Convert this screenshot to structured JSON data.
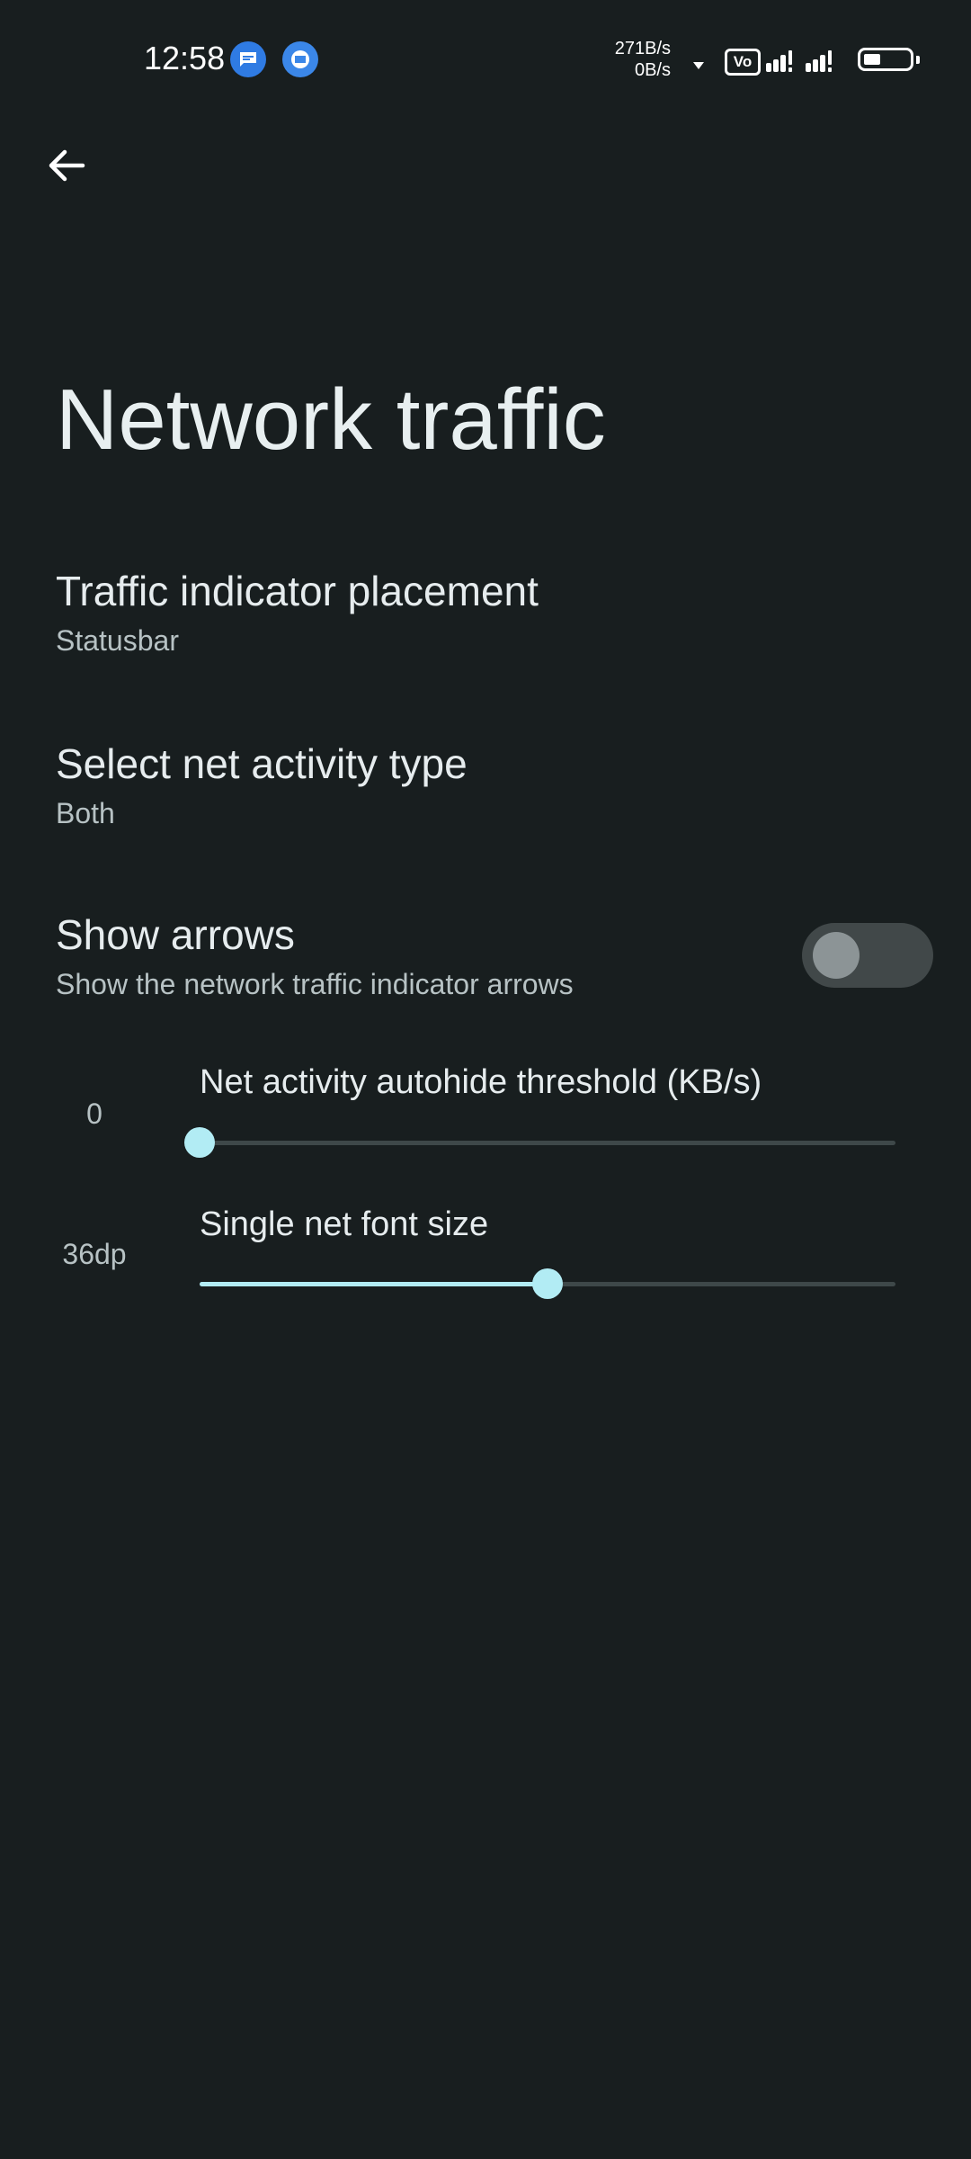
{
  "status_bar": {
    "time": "12:58",
    "speed_up": "271B/s",
    "speed_down": "0B/s",
    "volte": "Vo",
    "notification_icons": [
      "messages-icon",
      "chat-icon"
    ],
    "battery_level": 0.35
  },
  "header": {
    "back_icon": "arrow-back-icon",
    "title": "Network traffic"
  },
  "preferences": [
    {
      "title": "Traffic indicator placement",
      "summary": "Statusbar"
    },
    {
      "title": "Select net activity type",
      "summary": "Both"
    },
    {
      "title": "Show arrows",
      "summary": "Show the network traffic indicator arrows",
      "enabled": false
    }
  ],
  "sliders": [
    {
      "title": "Net activity autohide threshold (KB/s)",
      "value_label": "0",
      "fraction": 0.0
    },
    {
      "title": "Single net font size",
      "value_label": "36dp",
      "fraction": 0.5
    }
  ],
  "colors": {
    "background": "#181e1f",
    "accent": "#b2ecf4",
    "track": "#3e4849",
    "switch_track_off": "#414849"
  }
}
